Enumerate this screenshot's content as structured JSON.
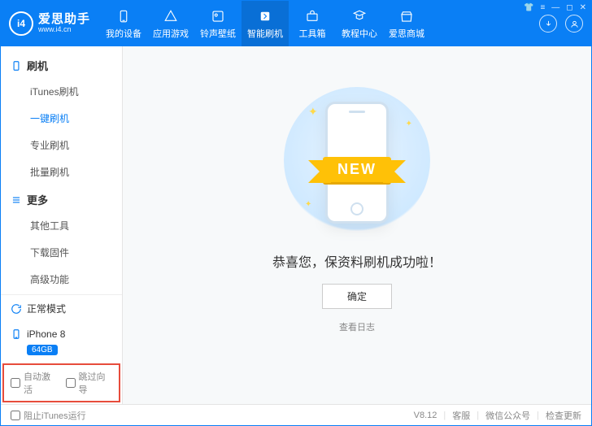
{
  "brand": {
    "logo_letters": "i4",
    "cn": "爱思助手",
    "en": "www.i4.cn"
  },
  "nav": [
    {
      "label": "我的设备"
    },
    {
      "label": "应用游戏"
    },
    {
      "label": "铃声壁纸"
    },
    {
      "label": "智能刷机"
    },
    {
      "label": "工具箱"
    },
    {
      "label": "教程中心"
    },
    {
      "label": "爱思商城"
    }
  ],
  "sidebar": {
    "group1": {
      "title": "刷机",
      "items": [
        "iTunes刷机",
        "一键刷机",
        "专业刷机",
        "批量刷机"
      ]
    },
    "group2": {
      "title": "更多",
      "items": [
        "其他工具",
        "下载固件",
        "高级功能"
      ]
    },
    "mode": "正常模式",
    "device": "iPhone 8",
    "storage": "64GB",
    "auto_activate": "自动激活",
    "skip_guide": "跳过向导"
  },
  "main": {
    "ribbon": "NEW",
    "success": "恭喜您，保资料刷机成功啦！",
    "ok": "确定",
    "view_log": "查看日志"
  },
  "footer": {
    "block_itunes": "阻止iTunes运行",
    "version": "V8.12",
    "support": "客服",
    "wechat": "微信公众号",
    "update": "检查更新"
  }
}
